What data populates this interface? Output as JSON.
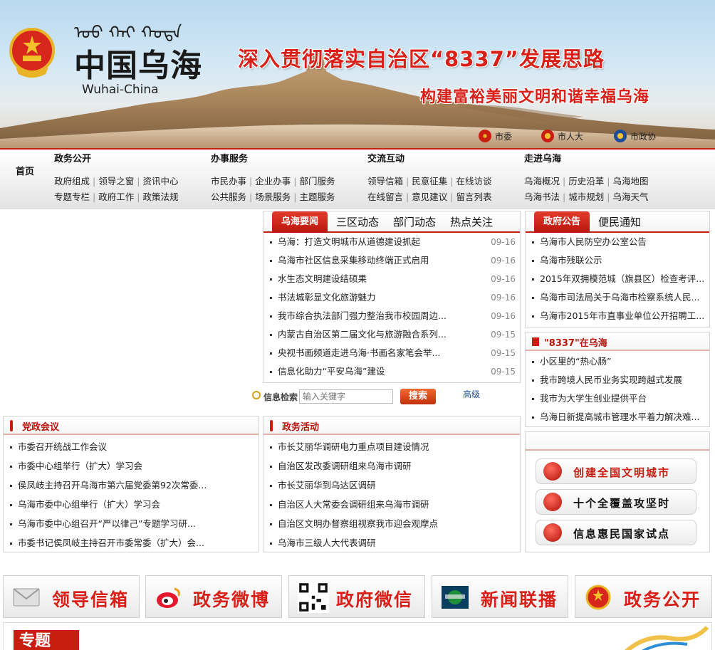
{
  "header": {
    "mongolian_script": "ᠣᠤ ᠬᠠᠢ ᠬᠣᠲᠠ",
    "city_name": "中国乌海",
    "city_name_en": "Wuhai-China",
    "slogan_line1": "深入贯彻落实自治区“8337”发展思路",
    "slogan_line2": "构建富裕美丽文明和谐幸福乌海",
    "top_links": [
      "市委",
      "市人大",
      "市政协"
    ]
  },
  "nav": {
    "home": "首页",
    "groups": [
      {
        "title": "政务公开",
        "row1": [
          "政府组成",
          "领导之窗",
          "资讯中心"
        ],
        "row2": [
          "专题专栏",
          "政府工作",
          "政策法规"
        ]
      },
      {
        "title": "办事服务",
        "row1": [
          "市民办事",
          "企业办事",
          "部门服务"
        ],
        "row2": [
          "公共服务",
          "场景服务",
          "主题服务"
        ]
      },
      {
        "title": "交流互动",
        "row1": [
          "领导信箱",
          "民意征集",
          "在线访谈"
        ],
        "row2": [
          "在线留言",
          "意见建议",
          "留言列表"
        ]
      },
      {
        "title": "走进乌海",
        "row1": [
          "乌海概况",
          "历史沿革",
          "乌海地图"
        ],
        "row2": [
          "乌海书法",
          "城市规划",
          "乌海天气"
        ]
      }
    ]
  },
  "news": {
    "tabs": [
      "乌海要闻",
      "三区动态",
      "部门动态",
      "热点关注"
    ],
    "items": [
      {
        "title": "乌海：打造文明城市从道德建设抓起",
        "date": "09-16"
      },
      {
        "title": "乌海市社区信息采集移动终端正式启用",
        "date": "09-16"
      },
      {
        "title": "水生态文明建设结硕果",
        "date": "09-16"
      },
      {
        "title": "书法城彰显文化旅游魅力",
        "date": "09-16"
      },
      {
        "title": "我市综合执法部门强力整治我市校园周边...",
        "date": "09-16"
      },
      {
        "title": "内蒙古自治区第二届文化与旅游融合系列...",
        "date": "09-15"
      },
      {
        "title": "央视书画频道走进乌海·书画名家笔会举...",
        "date": "09-15"
      },
      {
        "title": "信息化助力“平安乌海”建设",
        "date": "09-15"
      }
    ]
  },
  "search": {
    "label": "信息检索",
    "placeholder": "输入关键字",
    "button": "搜索",
    "advanced": "高级"
  },
  "notices": {
    "tabs": [
      "政府公告",
      "便民通知"
    ],
    "items": [
      "乌海市人民防空办公室公告",
      "乌海市残联公示",
      "2015年双拥模范城（旗县区）检查考评...",
      "乌海市司法局关于乌海市检察系统人民...",
      "乌海市2015年市直事业单位公开招聘工..."
    ]
  },
  "topic8337": {
    "title": "\"8337\"在乌海",
    "items": [
      "小区里的“热心肠”",
      "我市跨境人民币业务实现跨越式发展",
      "我市为大学生创业提供平台",
      "乌海日新提高城市管理水平着力解决难..."
    ]
  },
  "party_meetings": {
    "title": "党政会议",
    "items": [
      "市委召开统战工作会议",
      "市委中心组举行（扩大）学习会",
      "侯凤岐主持召开乌海市第六届党委第92次常委...",
      "乌海市委中心组举行（扩大）学习会",
      "乌海市委中心组召开“严以律己”专题学习研...",
      "市委书记侯凤岐主持召开市委常委（扩大）会..."
    ]
  },
  "gov_activities": {
    "title": "政务活动",
    "items": [
      "市长艾丽华调研电力重点项目建设情况",
      "自治区发改委调研组来乌海市调研",
      "市长艾丽华到乌达区调研",
      "自治区人大常委会调研组来乌海市调研",
      "自治区文明办督察组视察我市迎会观摩点",
      "乌海市三级人大代表调研"
    ]
  },
  "features": [
    "创建全国文明城市",
    "十个全覆盖攻坚时",
    "信息惠民国家试点"
  ],
  "bottom_banners": [
    "领导信箱",
    "政务微博",
    "政府微信",
    "新闻联播",
    "政务公开"
  ],
  "topic_bar": {
    "tag": "专题"
  },
  "colors": {
    "brand_red": "#c81d11",
    "slogan_red": "#d92018",
    "link_blue": "#1d4c99"
  }
}
